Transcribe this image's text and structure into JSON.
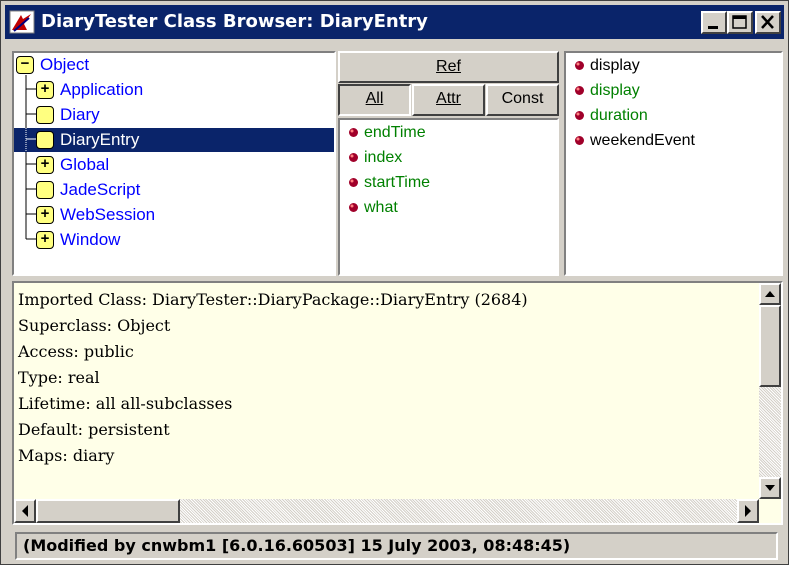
{
  "window": {
    "title": "DiaryTester Class Browser: DiaryEntry",
    "minimize_glyph": "_",
    "maximize_glyph": "□",
    "close_glyph": "✕"
  },
  "tree": {
    "root": "Object",
    "items": [
      {
        "label": "Application",
        "expander": "+"
      },
      {
        "label": "Diary",
        "expander": ""
      },
      {
        "label": "DiaryEntry",
        "expander": "",
        "selected": true
      },
      {
        "label": "Global",
        "expander": "+"
      },
      {
        "label": "JadeScript",
        "expander": ""
      },
      {
        "label": "WebSession",
        "expander": "+"
      },
      {
        "label": "Window",
        "expander": "+"
      }
    ]
  },
  "buttons": {
    "ref": "Ref",
    "all": "All",
    "attr": "Attr",
    "const": "Const"
  },
  "properties": [
    {
      "name": "endTime",
      "color": "#008000"
    },
    {
      "name": "index",
      "color": "#008000"
    },
    {
      "name": "startTime",
      "color": "#008000"
    },
    {
      "name": "what",
      "color": "#008000"
    }
  ],
  "methods": [
    {
      "name": "display",
      "color": "#000000"
    },
    {
      "name": "display",
      "color": "#008000"
    },
    {
      "name": "duration",
      "color": "#008000"
    },
    {
      "name": "weekendEvent",
      "color": "#000000"
    }
  ],
  "detail": {
    "lines": [
      "Imported Class: DiaryTester::DiaryPackage::DiaryEntry (2684)",
      "Superclass: Object",
      "Access: public",
      "Type: real",
      "Lifetime: all all-subclasses",
      "Default: persistent",
      "Maps: diary"
    ]
  },
  "status": {
    "text": "(Modified by cnwbm1 [6.0.16.60503] 15 July 2003, 08:48:45)"
  },
  "icons": {
    "app": "class-browser-icon",
    "dot": "method-dot-icon"
  },
  "colors": {
    "titlebar": "#0a246a",
    "link": "#0000ff",
    "green_item": "#008000",
    "dot": "#a0002a",
    "detail_bg": "#ffffe8"
  }
}
